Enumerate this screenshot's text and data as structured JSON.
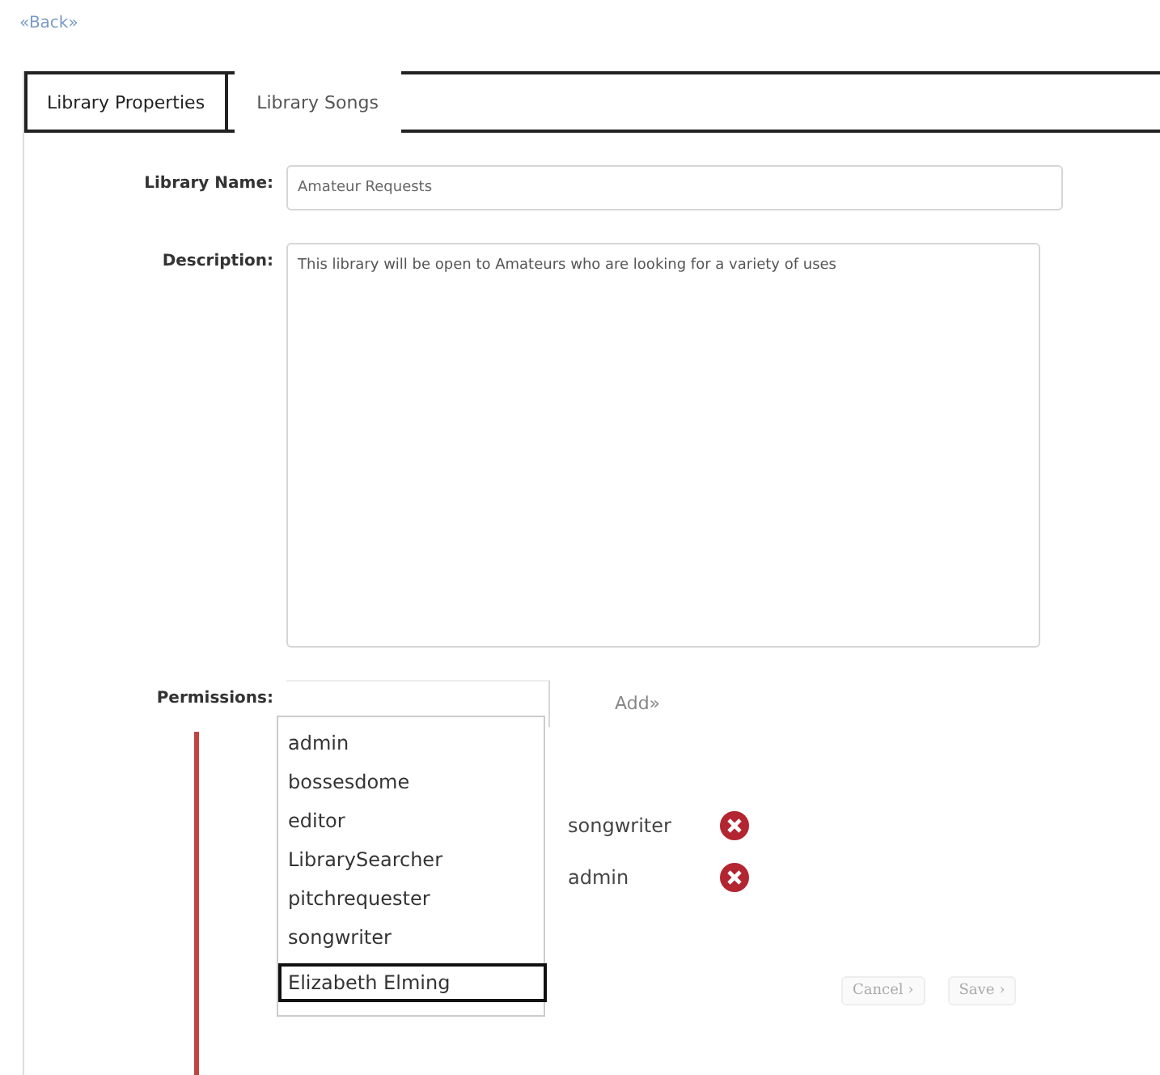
{
  "back_link": "«Back»",
  "tabs": [
    {
      "label": "Library Properties",
      "selected": true
    },
    {
      "label": "Library Songs",
      "selected": false
    }
  ],
  "form": {
    "name_label": "Library Name:",
    "name_value": "Amateur Requests",
    "description_label": "Description:",
    "description_value": "This library will be open to Amateurs who are looking for a variety of uses",
    "permissions_label": "Permissions:",
    "add_button": "Add»"
  },
  "permissions": [
    {
      "role": "songwriter"
    },
    {
      "role": "admin"
    }
  ],
  "dropdown": [
    {
      "label": "admin",
      "selected": false
    },
    {
      "label": "bossesdome",
      "selected": false
    },
    {
      "label": "editor",
      "selected": false
    },
    {
      "label": "LibrarySearcher",
      "selected": false
    },
    {
      "label": "pitchrequester",
      "selected": false
    },
    {
      "label": "songwriter",
      "selected": false
    },
    {
      "label": "Elizabeth Elming",
      "selected": true
    }
  ],
  "buttons": [
    "Cancel ›",
    "Save ›"
  ]
}
